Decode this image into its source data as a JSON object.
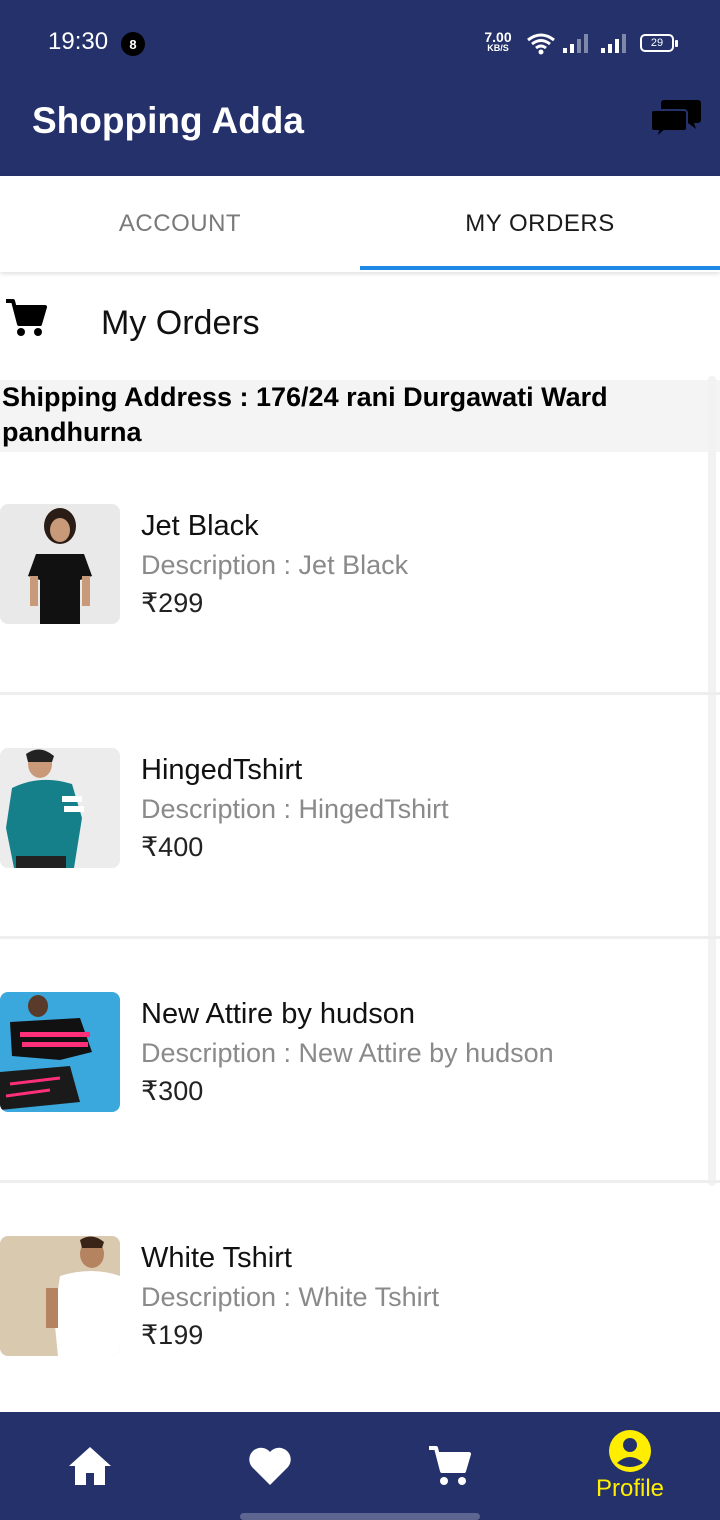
{
  "status_bar": {
    "time": "19:30",
    "notification_count": "8",
    "speed_value": "7.00",
    "speed_unit": "KB/S",
    "battery": "29"
  },
  "app_bar": {
    "title": "Shopping Adda",
    "chat_icon": "chat-bubbles-icon"
  },
  "tabs": {
    "account": "ACCOUNT",
    "my_orders": "MY ORDERS",
    "selected": "my_orders",
    "indicator_color": "#1e88e5"
  },
  "section": {
    "icon": "cart-icon",
    "title": "My Orders"
  },
  "shipping": {
    "text": "Shipping Address : 176/24 rani Durgawati Ward pandhurna"
  },
  "orders": [
    {
      "name": "Jet Black",
      "description": "Description : Jet Black",
      "price": "₹299"
    },
    {
      "name": "HingedTshirt",
      "description": "Description : HingedTshirt",
      "price": "₹400"
    },
    {
      "name": "New Attire by hudson",
      "description": "Description : New Attire by hudson",
      "price": "₹300"
    },
    {
      "name": "White Tshirt",
      "description": "Description : White Tshirt",
      "price": "₹199"
    }
  ],
  "bottom_nav": {
    "items": [
      {
        "icon": "home-icon"
      },
      {
        "icon": "heart-icon"
      },
      {
        "icon": "cart-icon"
      },
      {
        "icon": "profile-icon",
        "label": "Profile"
      }
    ],
    "active_color": "#ffee00"
  },
  "colors": {
    "primary": "#25316a",
    "accent": "#1e88e5",
    "active_nav": "#ffee00"
  }
}
